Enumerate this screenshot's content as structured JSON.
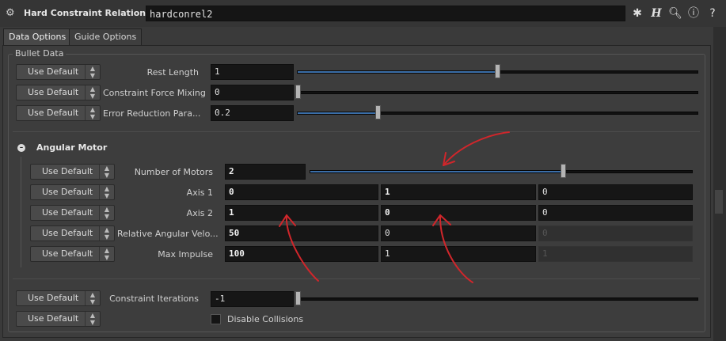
{
  "header": {
    "node_type": "Hard Constraint Relationship",
    "node_name": "hardconrel2",
    "icons": [
      "node-type-icon",
      "gear-icon",
      "help-h-icon",
      "search-icon",
      "info-icon",
      "help-icon"
    ]
  },
  "tabs": [
    {
      "label": "Data Options",
      "active": true
    },
    {
      "label": "Guide Options",
      "active": false
    }
  ],
  "bullet_data": {
    "label": "Bullet Data",
    "use_default_label": "Use Default",
    "rows": [
      {
        "label": "Rest Length",
        "value": "1",
        "slider_fraction": 0.5
      },
      {
        "label": "Constraint Force Mixing",
        "value": "0",
        "slider_fraction": 0.0
      },
      {
        "label": "Error Reduction Para...",
        "value": "0.2",
        "slider_fraction": 0.2
      }
    ]
  },
  "angular_motor": {
    "title": "Angular Motor",
    "number_of_motors": {
      "label": "Number of Motors",
      "value": "2",
      "slider_fraction": 0.67
    },
    "rows": [
      {
        "label": "Axis 1",
        "values": [
          "0",
          "1",
          "0"
        ]
      },
      {
        "label": "Axis 2",
        "values": [
          "1",
          "0",
          "0"
        ]
      },
      {
        "label": "Relative Angular Velo...",
        "values": [
          "50",
          "0",
          "0"
        ]
      },
      {
        "label": "Max Impulse",
        "values": [
          "100",
          "1",
          "1"
        ]
      }
    ]
  },
  "constraint_iterations": {
    "label": "Constraint Iterations",
    "value": "-1",
    "slider_fraction": 0.0
  },
  "disable_collisions": {
    "label": "Disable Collisions",
    "checked": false
  },
  "colors": {
    "annotation": "#d0262b",
    "slider_fill": "#3b6ea8"
  }
}
